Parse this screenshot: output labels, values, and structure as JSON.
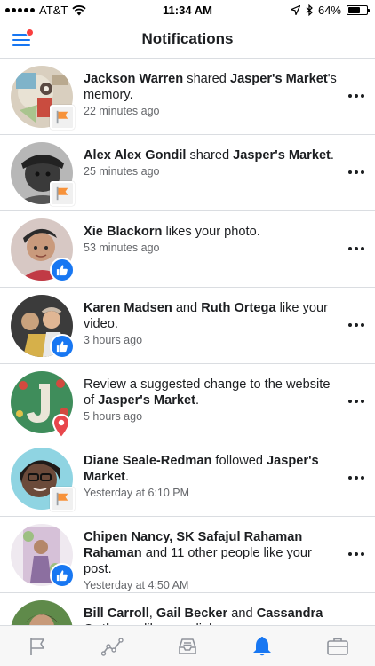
{
  "status": {
    "carrier": "AT&T",
    "time": "11:34 AM",
    "battery": "64%",
    "battery_level": 0.64
  },
  "header": {
    "title": "Notifications",
    "menu_has_alert": true
  },
  "notifications": [
    {
      "parts": [
        [
          "Jackson Warren",
          true
        ],
        [
          " shared ",
          false
        ],
        [
          "Jasper's Market",
          true
        ],
        [
          "'s memory.",
          false
        ]
      ],
      "time": "22 minutes ago",
      "badge": "page-flag-icon"
    },
    {
      "parts": [
        [
          "Alex Alex Gondil",
          true
        ],
        [
          " shared ",
          false
        ],
        [
          "Jasper's Market",
          true
        ],
        [
          ".",
          false
        ]
      ],
      "time": "25 minutes ago",
      "badge": "page-flag-icon"
    },
    {
      "parts": [
        [
          "Xie Blackorn",
          true
        ],
        [
          " likes your photo.",
          false
        ]
      ],
      "time": "53 minutes ago",
      "badge": "like-icon"
    },
    {
      "parts": [
        [
          "Karen Madsen",
          true
        ],
        [
          " and ",
          false
        ],
        [
          "Ruth Ortega",
          true
        ],
        [
          " like your video.",
          false
        ]
      ],
      "time": "3 hours ago",
      "badge": "like-icon"
    },
    {
      "parts": [
        [
          "Review a suggested change to the website of ",
          false
        ],
        [
          "Jasper's Market",
          true
        ],
        [
          ".",
          false
        ]
      ],
      "time": "5 hours ago",
      "badge": "location-pin-icon"
    },
    {
      "parts": [
        [
          "Diane Seale-Redman",
          true
        ],
        [
          " followed ",
          false
        ],
        [
          "Jasper's Market",
          true
        ],
        [
          ".",
          false
        ]
      ],
      "time": "Yesterday at 6:10 PM",
      "badge": "page-flag-icon"
    },
    {
      "parts": [
        [
          "Chipen Nancy, SK Safajul Rahaman Rahaman",
          true
        ],
        [
          " and 11 other people like your post.",
          false
        ]
      ],
      "time": "Yesterday at 4:50 AM",
      "badge": "like-icon"
    },
    {
      "parts": [
        [
          "Bill Carroll",
          true
        ],
        [
          ", ",
          false
        ],
        [
          "Gail Becker",
          true
        ],
        [
          " and ",
          false
        ],
        [
          "Cassandra Outhman",
          true
        ],
        [
          " like your link.",
          false
        ]
      ],
      "time": "",
      "badge": ""
    }
  ],
  "tabs": [
    {
      "icon": "flag-icon",
      "active": false
    },
    {
      "icon": "insights-icon",
      "active": false
    },
    {
      "icon": "inbox-icon",
      "active": false
    },
    {
      "icon": "bell-icon",
      "active": true
    },
    {
      "icon": "briefcase-icon",
      "active": false
    }
  ],
  "colors": {
    "accent": "#1877f2",
    "alert": "#fa3e3e",
    "pin": "#e8474c",
    "page_flag": "#f7923a"
  }
}
